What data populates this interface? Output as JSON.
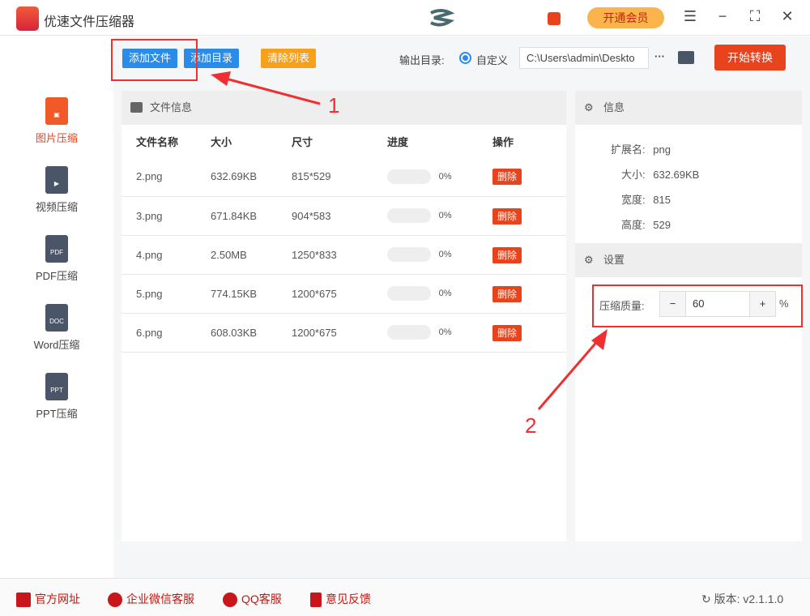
{
  "app": {
    "title": "优速文件压缩器",
    "vip_label": "开通会员"
  },
  "toolbar": {
    "add_file": "添加文件",
    "add_folder": "添加目录",
    "clear_list": "清除列表",
    "output_label": "输出目录:",
    "radio_label": "自定义",
    "output_path": "C:\\Users\\admin\\Deskto",
    "more": "···",
    "start": "开始转换"
  },
  "sidebar": {
    "items": [
      {
        "label": "图片压缩",
        "icon": "image"
      },
      {
        "label": "视频压缩",
        "icon": "video"
      },
      {
        "label": "PDF压缩",
        "icon": "PDF"
      },
      {
        "label": "Word压缩",
        "icon": "DOC"
      },
      {
        "label": "PPT压缩",
        "icon": "PPT"
      }
    ]
  },
  "files": {
    "header": "文件信息",
    "columns": [
      "文件名称",
      "大小",
      "尺寸",
      "进度",
      "操作"
    ],
    "rows": [
      {
        "name": "2.png",
        "size": "632.69KB",
        "dim": "815*529",
        "progress": "0%",
        "action": "删除"
      },
      {
        "name": "3.png",
        "size": "671.84KB",
        "dim": "904*583",
        "progress": "0%",
        "action": "删除"
      },
      {
        "name": "4.png",
        "size": "2.50MB",
        "dim": "1250*833",
        "progress": "0%",
        "action": "删除"
      },
      {
        "name": "5.png",
        "size": "774.15KB",
        "dim": "1200*675",
        "progress": "0%",
        "action": "删除"
      },
      {
        "name": "6.png",
        "size": "608.03KB",
        "dim": "1200*675",
        "progress": "0%",
        "action": "删除"
      }
    ]
  },
  "info": {
    "header": "信息",
    "ext_label": "扩展名:",
    "ext": "png",
    "size_label": "大小:",
    "size": "632.69KB",
    "width_label": "宽度:",
    "width": "815",
    "height_label": "高度:",
    "height": "529"
  },
  "settings": {
    "header": "设置",
    "quality_label": "压缩质量:",
    "quality": "60",
    "minus": "−",
    "plus": "+",
    "unit": "%"
  },
  "annotations": {
    "one": "1",
    "two": "2"
  },
  "footer": {
    "website": "官方网址",
    "wechat": "企业微信客服",
    "qq": "QQ客服",
    "feedback": "意见反馈",
    "version": "版本: v2.1.1.0"
  }
}
